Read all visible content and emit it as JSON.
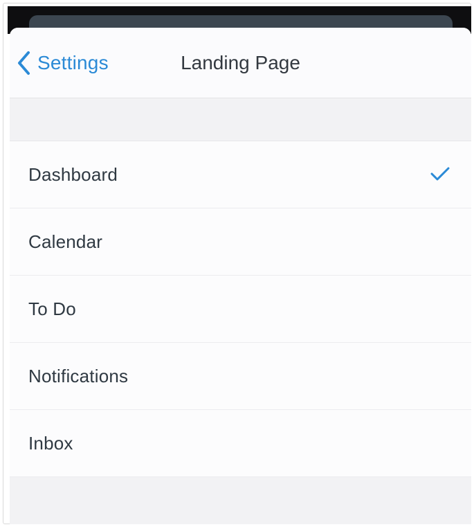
{
  "nav": {
    "back_label": "Settings",
    "title": "Landing Page"
  },
  "options": [
    {
      "label": "Dashboard",
      "selected": true
    },
    {
      "label": "Calendar",
      "selected": false
    },
    {
      "label": "To Do",
      "selected": false
    },
    {
      "label": "Notifications",
      "selected": false
    },
    {
      "label": "Inbox",
      "selected": false
    }
  ],
  "colors": {
    "accent": "#2b8ad6",
    "text": "#2f3942",
    "background_group": "#f2f2f4"
  },
  "icons": {
    "back": "chevron-left-icon",
    "selected": "checkmark-icon"
  }
}
